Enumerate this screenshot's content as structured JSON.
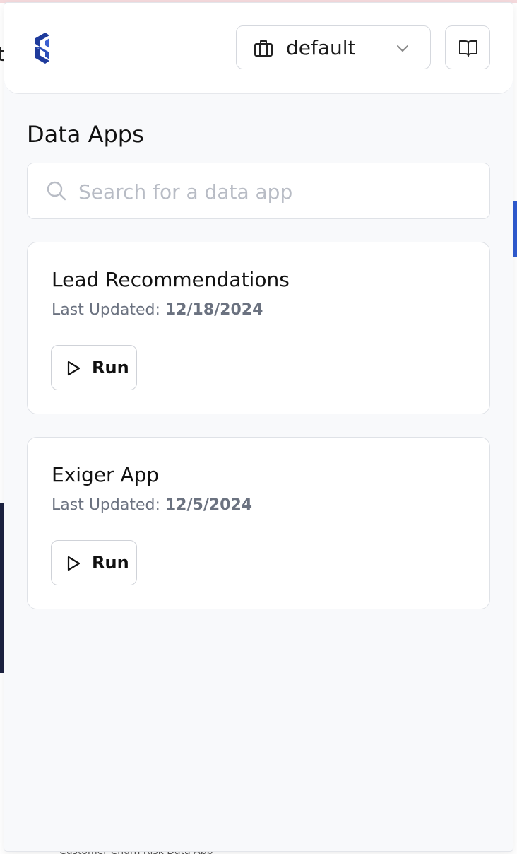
{
  "workspace": {
    "selected": "default"
  },
  "main": {
    "title": "Data Apps",
    "search": {
      "placeholder": "Search for a data app",
      "value": ""
    },
    "apps": [
      {
        "name": "Lead Recommendations",
        "updated_label": "Last Updated:",
        "updated_date": "12/18/2024",
        "run_label": "Run"
      },
      {
        "name": "Exiger App",
        "updated_label": "Last Updated:",
        "updated_date": "12/5/2024",
        "run_label": "Run"
      }
    ]
  },
  "background": {
    "left_fragment": "t",
    "bottom_fragment": "Customer Churn Risk Data App"
  },
  "colors": {
    "logo": "#1f3b9c",
    "panel_background": "#f8f9fb",
    "card_border": "#dfe2e7",
    "muted_text": "#6b7280",
    "placeholder": "#b8bcc5"
  },
  "icons": {
    "logo": "brand-logo-icon",
    "workspace": "briefcase-icon",
    "dropdown": "chevron-down-icon",
    "docs": "open-book-icon",
    "search": "search-icon",
    "run": "play-icon"
  }
}
